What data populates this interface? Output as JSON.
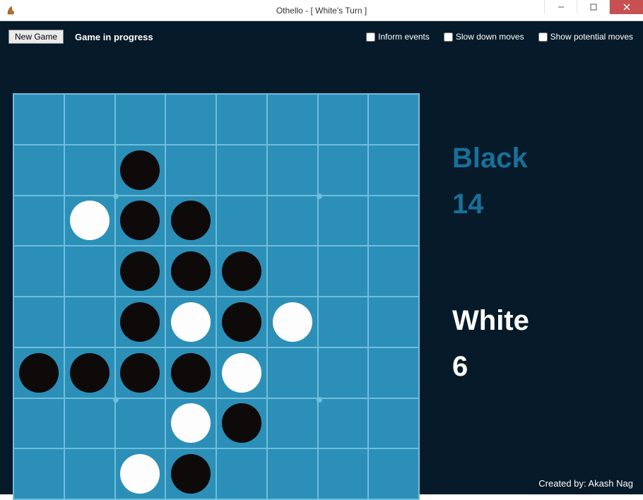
{
  "window": {
    "title": "Othello - [ White's Turn ]"
  },
  "toolbar": {
    "new_game_label": "New Game",
    "status": "Game in progress",
    "checkboxes": [
      {
        "label": "Inform events",
        "checked": false
      },
      {
        "label": "Slow down moves",
        "checked": false
      },
      {
        "label": "Show potential moves",
        "checked": false
      }
    ]
  },
  "scores": {
    "black": {
      "label": "Black",
      "value": "14"
    },
    "white": {
      "label": "White",
      "value": "6"
    }
  },
  "credits": "Created by: Akash Nag",
  "board": {
    "size": 8,
    "cells": [
      [
        null,
        null,
        null,
        null,
        null,
        null,
        null,
        null
      ],
      [
        null,
        null,
        "B",
        null,
        null,
        null,
        null,
        null
      ],
      [
        null,
        "W",
        "B",
        "B",
        null,
        null,
        null,
        null
      ],
      [
        null,
        null,
        "B",
        "B",
        "B",
        null,
        null,
        null
      ],
      [
        null,
        null,
        "B",
        "W",
        "B",
        "W",
        null,
        null
      ],
      [
        "B",
        "B",
        "B",
        "B",
        "W",
        null,
        null,
        null
      ],
      [
        null,
        null,
        null,
        "W",
        "B",
        null,
        null,
        null
      ],
      [
        null,
        null,
        "W",
        "B",
        null,
        null,
        null,
        null
      ]
    ],
    "guide_dots": [
      {
        "row": 2,
        "col": 2
      },
      {
        "row": 2,
        "col": 6
      },
      {
        "row": 6,
        "col": 2
      },
      {
        "row": 6,
        "col": 6
      }
    ]
  },
  "colors": {
    "panel_bg": "#061a29",
    "board_bg": "#2b8fb8",
    "grid": "#6fbedb",
    "black_score": "#1a6f98"
  }
}
